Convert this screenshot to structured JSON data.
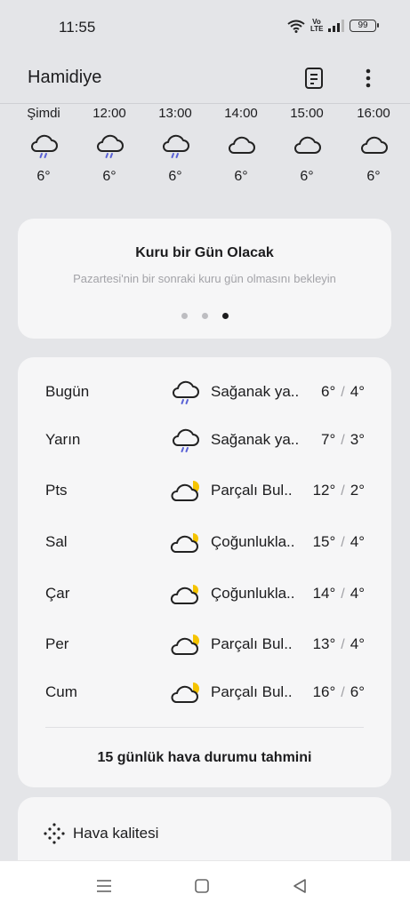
{
  "status_bar": {
    "time": "11:55",
    "volte_top": "Vo",
    "volte_bottom": "LTE",
    "battery": "99"
  },
  "header": {
    "city": "Hamidiye",
    "icons": [
      "list-document-icon",
      "more-vertical-icon"
    ]
  },
  "hourly": [
    {
      "time": "Şimdi",
      "icon": "rain-cloud-icon",
      "temp": "6°"
    },
    {
      "time": "12:00",
      "icon": "rain-cloud-icon",
      "temp": "6°"
    },
    {
      "time": "13:00",
      "icon": "rain-cloud-icon",
      "temp": "6°"
    },
    {
      "time": "14:00",
      "icon": "cloud-icon",
      "temp": "6°"
    },
    {
      "time": "15:00",
      "icon": "cloud-icon",
      "temp": "6°"
    },
    {
      "time": "16:00",
      "icon": "cloud-icon",
      "temp": "6°"
    }
  ],
  "summary": {
    "title": "Kuru bir Gün Olacak",
    "subtitle": "Pazartesi'nin bir sonraki kuru gün olmasını bekleyin",
    "pages": 3,
    "active_page": 3
  },
  "forecast": {
    "rows": [
      {
        "day": "Bugün",
        "icon": "rain-cloud-icon",
        "condition": "Sağanak ya..",
        "high": "6°",
        "low": "4°"
      },
      {
        "day": "Yarın",
        "icon": "rain-cloud-icon",
        "condition": "Sağanak ya..",
        "high": "7°",
        "low": "3°"
      },
      {
        "day": "Pts",
        "icon": "partly-cloudy-icon",
        "condition": "Parçalı Bul..",
        "high": "12°",
        "low": "2°"
      },
      {
        "day": "Sal",
        "icon": "mostly-cloudy-icon",
        "condition": "Çoğunlukla..",
        "high": "15°",
        "low": "4°"
      },
      {
        "day": "Çar",
        "icon": "mostly-cloudy-icon",
        "condition": "Çoğunlukla..",
        "high": "14°",
        "low": "4°"
      },
      {
        "day": "Per",
        "icon": "partly-cloudy-icon",
        "condition": "Parçalı Bul..",
        "high": "13°",
        "low": "4°"
      },
      {
        "day": "Cum",
        "icon": "partly-cloudy-icon",
        "condition": "Parçalı Bul..",
        "high": "16°",
        "low": "6°"
      }
    ],
    "separator": "/",
    "link": "15 günlük hava durumu tahmini"
  },
  "air_quality": {
    "label": "Hava kalitesi"
  },
  "colors": {
    "rain": "#5b63d6",
    "sun": "#f5c400",
    "background": "#e4e5e8",
    "card": "#f6f6f7"
  }
}
